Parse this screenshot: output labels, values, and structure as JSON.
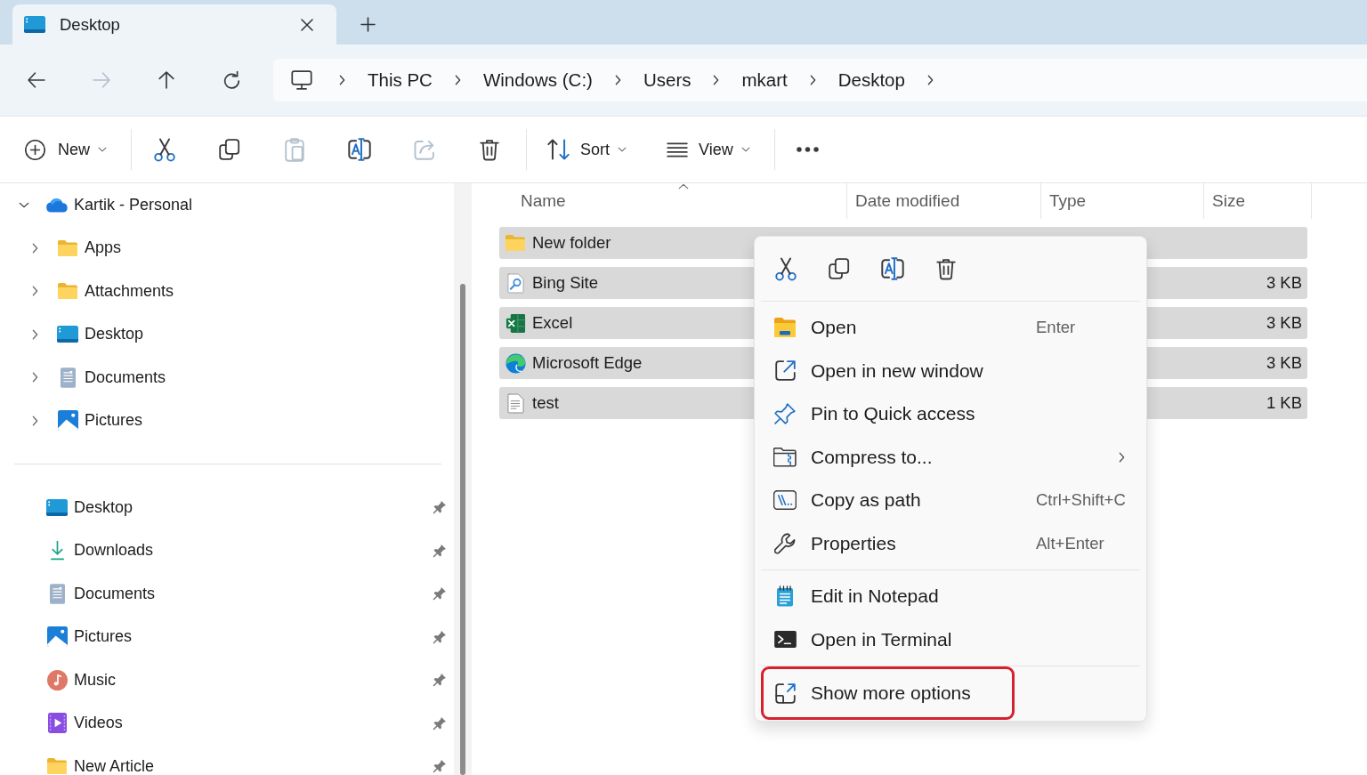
{
  "tabs": [
    {
      "title": "Desktop",
      "selected": true
    }
  ],
  "navigation": [
    {
      "kind": "back",
      "disabled": false
    },
    {
      "kind": "forward",
      "disabled": true
    },
    {
      "kind": "up",
      "disabled": false
    },
    {
      "kind": "refresh",
      "disabled": false
    }
  ],
  "breadcrumb": [
    "This PC",
    "Windows (C:)",
    "Users",
    "mkart",
    "Desktop"
  ],
  "toolbar": [
    {
      "kind": "new",
      "label": "New"
    },
    {
      "kind": "separator"
    },
    {
      "kind": "cut",
      "disabled": false
    },
    {
      "kind": "copy",
      "disabled": false
    },
    {
      "kind": "paste",
      "disabled": true
    },
    {
      "kind": "rename",
      "disabled": false
    },
    {
      "kind": "share",
      "disabled": true
    },
    {
      "kind": "delete",
      "disabled": false
    },
    {
      "kind": "separator"
    },
    {
      "kind": "sort",
      "label": "Sort"
    },
    {
      "kind": "view",
      "label": "View"
    },
    {
      "kind": "separator"
    },
    {
      "kind": "more",
      "disabled": false
    }
  ],
  "sidebar": {
    "tree": [
      {
        "label": "Kartik - Personal",
        "kind": "cloud",
        "expanded": true,
        "children": [
          {
            "label": "Apps",
            "kind": "folder",
            "expanded": false
          },
          {
            "label": "Attachments",
            "kind": "folder",
            "expanded": false
          },
          {
            "label": "Desktop",
            "kind": "desktop",
            "expanded": false
          },
          {
            "label": "Documents",
            "kind": "documents",
            "expanded": false
          },
          {
            "label": "Pictures",
            "kind": "pictures",
            "expanded": false
          }
        ]
      }
    ],
    "quick_access": [
      {
        "label": "Desktop",
        "kind": "desktop",
        "pinned": true
      },
      {
        "label": "Downloads",
        "kind": "downloads",
        "pinned": true
      },
      {
        "label": "Documents",
        "kind": "documents",
        "pinned": true
      },
      {
        "label": "Pictures",
        "kind": "pictures",
        "pinned": true
      },
      {
        "label": "Music",
        "kind": "music",
        "pinned": true
      },
      {
        "label": "Videos",
        "kind": "videos",
        "pinned": true
      },
      {
        "label": "New Article",
        "kind": "folder",
        "pinned": true
      }
    ]
  },
  "file_list": {
    "columns": [
      {
        "label": "Name",
        "sorted": true
      },
      {
        "label": "Date modified",
        "sorted": false
      },
      {
        "label": "Type",
        "sorted": false
      },
      {
        "label": "Size",
        "sorted": false
      }
    ],
    "rows": [
      {
        "name": "New folder",
        "kind": "folder",
        "selected": true
      },
      {
        "name": "Bing Site",
        "kind": "web-shortcut",
        "size": "3 KB",
        "selected": true
      },
      {
        "name": "Excel",
        "kind": "spreadsheet-shortcut",
        "size": "3 KB",
        "selected": true
      },
      {
        "name": "Microsoft Edge",
        "kind": "browser-shortcut",
        "size": "3 KB",
        "selected": true
      },
      {
        "name": "test",
        "kind": "text-shortcut",
        "size": "1 KB",
        "selected": true
      }
    ]
  },
  "context_menu": {
    "actions": [
      {
        "kind": "cut"
      },
      {
        "kind": "copy"
      },
      {
        "kind": "rename"
      },
      {
        "kind": "delete"
      }
    ],
    "groups": [
      {
        "items": [
          {
            "kind": "open",
            "label": "Open",
            "shortcut": "Enter",
            "submenu": false,
            "highlighted": false
          },
          {
            "kind": "open-window",
            "label": "Open in new window",
            "submenu": false,
            "highlighted": false
          },
          {
            "kind": "pin",
            "label": "Pin to Quick access",
            "submenu": false,
            "highlighted": false
          },
          {
            "kind": "compress",
            "label": "Compress to...",
            "submenu": true,
            "highlighted": false
          },
          {
            "kind": "copy-path",
            "label": "Copy as path",
            "shortcut": "Ctrl+Shift+C",
            "submenu": false,
            "highlighted": false
          },
          {
            "kind": "properties",
            "label": "Properties",
            "shortcut": "Alt+Enter",
            "submenu": false,
            "highlighted": false
          }
        ]
      },
      {
        "items": [
          {
            "kind": "notepad",
            "label": "Edit in Notepad",
            "submenu": false,
            "highlighted": false
          },
          {
            "kind": "terminal",
            "label": "Open in Terminal",
            "submenu": false,
            "highlighted": false
          }
        ]
      },
      {
        "items": [
          {
            "kind": "more-options",
            "label": "Show more options",
            "submenu": false,
            "highlighted": true
          }
        ]
      }
    ]
  }
}
